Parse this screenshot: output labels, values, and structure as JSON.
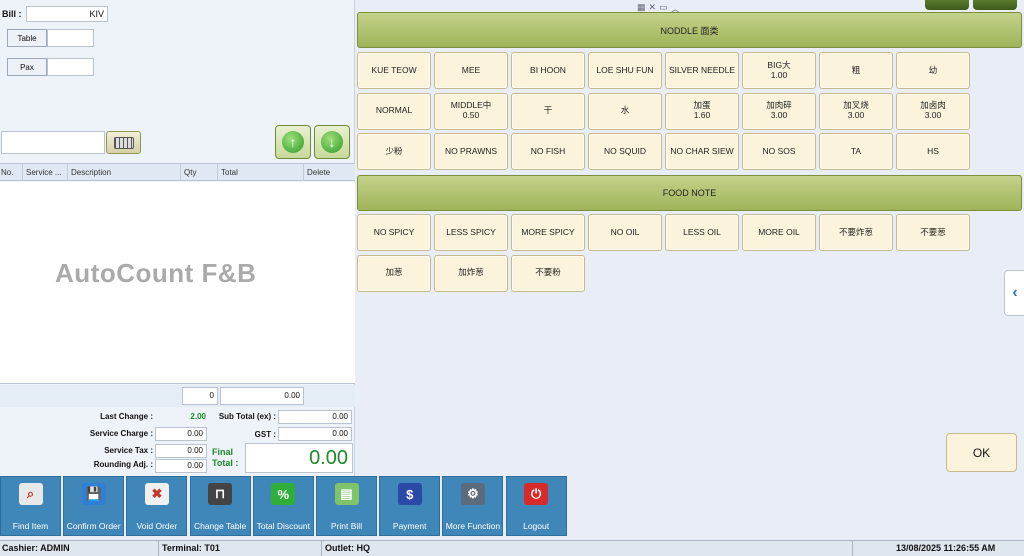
{
  "header": {
    "bill_label": "Bill :",
    "bill_value": "KIV",
    "table_label": "Table",
    "table_value": "",
    "pax_label": "Pax",
    "pax_value": "",
    "search_value": ""
  },
  "grid": {
    "columns": [
      "No.",
      "Service ...",
      "Description",
      "Qty",
      "Total",
      "Delete"
    ],
    "watermark": "AutoCount F&B",
    "qty_total": "0",
    "amount_total": "0.00"
  },
  "summary": {
    "last_change_label": "Last Change :",
    "last_change_value": "2.00",
    "service_charge_label": "Service Charge :",
    "service_charge_value": "0.00",
    "service_tax_label": "Service Tax :",
    "service_tax_value": "0.00",
    "rounding_label": "Rounding Adj. :",
    "rounding_value": "0.00",
    "subtotal_label": "Sub Total (ex) :",
    "subtotal_value": "0.00",
    "gst_label": "GST :",
    "gst_value": "0.00",
    "final_label_1": "Final",
    "final_label_2": "Total :",
    "final_value": "0.00"
  },
  "sections": {
    "noodle_title": "NODDLE 面类",
    "food_note_title": "FOOD NOTE"
  },
  "noodle_rows": [
    [
      {
        "t": "KUE TEOW",
        "p": ""
      },
      {
        "t": "MEE",
        "p": ""
      },
      {
        "t": "BI HOON",
        "p": ""
      },
      {
        "t": "LOE SHU FUN",
        "p": ""
      },
      {
        "t": "SILVER NEEDLE",
        "p": ""
      },
      {
        "t": "BIG大",
        "p": "1.00"
      },
      {
        "t": "粗",
        "p": ""
      },
      {
        "t": "幼",
        "p": ""
      }
    ],
    [
      {
        "t": "NORMAL",
        "p": ""
      },
      {
        "t": "MIDDLE中",
        "p": "0.50"
      },
      {
        "t": "干",
        "p": ""
      },
      {
        "t": "水",
        "p": ""
      },
      {
        "t": "加蛋",
        "p": "1.60"
      },
      {
        "t": "加肉碎",
        "p": "3.00"
      },
      {
        "t": "加叉烧",
        "p": "3.00"
      },
      {
        "t": "加卤肉",
        "p": "3.00"
      }
    ],
    [
      {
        "t": "少粉",
        "p": ""
      },
      {
        "t": "NO PRAWNS",
        "p": ""
      },
      {
        "t": "NO FISH",
        "p": ""
      },
      {
        "t": "NO SQUID",
        "p": ""
      },
      {
        "t": "NO CHAR SIEW",
        "p": ""
      },
      {
        "t": "NO SOS",
        "p": ""
      },
      {
        "t": "TA",
        "p": ""
      },
      {
        "t": "HS",
        "p": ""
      }
    ]
  ],
  "note_rows": [
    [
      {
        "t": "NO SPICY"
      },
      {
        "t": "LESS SPICY"
      },
      {
        "t": "MORE SPICY"
      },
      {
        "t": "NO OIL"
      },
      {
        "t": "LESS OIL"
      },
      {
        "t": "MORE OIL"
      },
      {
        "t": "不要炸葱"
      },
      {
        "t": "不要葱"
      }
    ],
    [
      {
        "t": "加葱"
      },
      {
        "t": "加炸葱"
      },
      {
        "t": "不要粉"
      }
    ]
  ],
  "ok_label": "OK",
  "toolbar": [
    {
      "label": "Find Item",
      "icon": "search-icon",
      "color": "#e8e8e8",
      "glyph": "⌕"
    },
    {
      "label": "Confirm Order",
      "icon": "save-icon",
      "color": "#2f7fd6",
      "glyph": "💾"
    },
    {
      "label": "Void Order",
      "icon": "void-icon",
      "color": "#f0f0f0",
      "glyph": "✖"
    },
    {
      "label": "Change Table",
      "icon": "table-icon",
      "color": "#444444",
      "glyph": "⊓"
    },
    {
      "label": "Total Discount",
      "icon": "percent-icon",
      "color": "#2fae3a",
      "glyph": "%"
    },
    {
      "label": "Print Bill",
      "icon": "printer-icon",
      "color": "#7fc46a",
      "glyph": "▤"
    },
    {
      "label": "Payment",
      "icon": "payment-icon",
      "color": "#2b4aa8",
      "glyph": "$"
    },
    {
      "label": "More Function",
      "icon": "gear-icon",
      "color": "#5a6b7c",
      "glyph": "⚙"
    },
    {
      "label": "Logout",
      "icon": "power-icon",
      "color": "#d62b2b",
      "glyph": "⏻"
    }
  ],
  "status": {
    "cashier": "Cashier: ADMIN",
    "terminal": "Terminal: T01",
    "outlet": "Outlet: HQ",
    "datetime": "13/08/2025 11:26:55 AM"
  }
}
